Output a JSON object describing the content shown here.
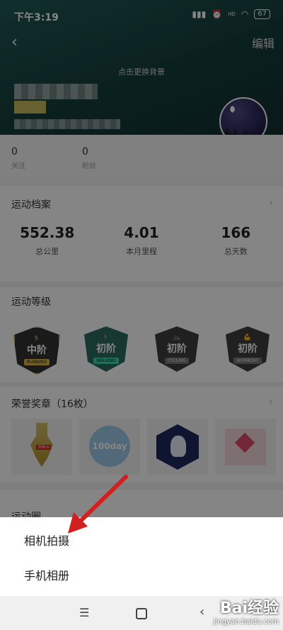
{
  "status_bar": {
    "time": "下午3:19",
    "battery": "67",
    "hd_label": "HD"
  },
  "header": {
    "edit_label": "编辑",
    "change_bg_label": "点击更换背景"
  },
  "follow_stats": [
    {
      "value": "0",
      "label": "关注"
    },
    {
      "value": "0",
      "label": "粉丝"
    }
  ],
  "sport_record": {
    "title": "运动档案",
    "items": [
      {
        "value": "552.38",
        "label": "总公里"
      },
      {
        "value": "4.01",
        "label": "本月里程"
      },
      {
        "value": "166",
        "label": "总天数"
      }
    ]
  },
  "sport_level": {
    "title": "运动等级",
    "badges": [
      {
        "level": "中阶",
        "type": "RUNNING",
        "color": "#3a3a3a",
        "accent": "#d6b64c"
      },
      {
        "level": "初阶",
        "type": "WALKING",
        "color": "#2c6a5e",
        "accent": "#3ed6a4"
      },
      {
        "level": "初阶",
        "type": "CYCLING",
        "color": "#3f3f3f",
        "accent": "#bdbdbd"
      },
      {
        "level": "初阶",
        "type": "WORKOUT",
        "color": "#3f3f3f",
        "accent": "#bdbdbd"
      }
    ]
  },
  "honor_medals": {
    "title": "荣誉奖章（16枚）",
    "medal_texts": [
      "30km",
      "100day"
    ]
  },
  "next_section_title": "运动圈",
  "action_sheet": {
    "items": [
      "相机拍摄",
      "手机相册"
    ]
  },
  "watermark": {
    "brand": "Bai经验",
    "url": "jingyan.baidu.com"
  },
  "colors": {
    "header_bg": "#1a4a47",
    "arrow": "#d21f1f"
  }
}
